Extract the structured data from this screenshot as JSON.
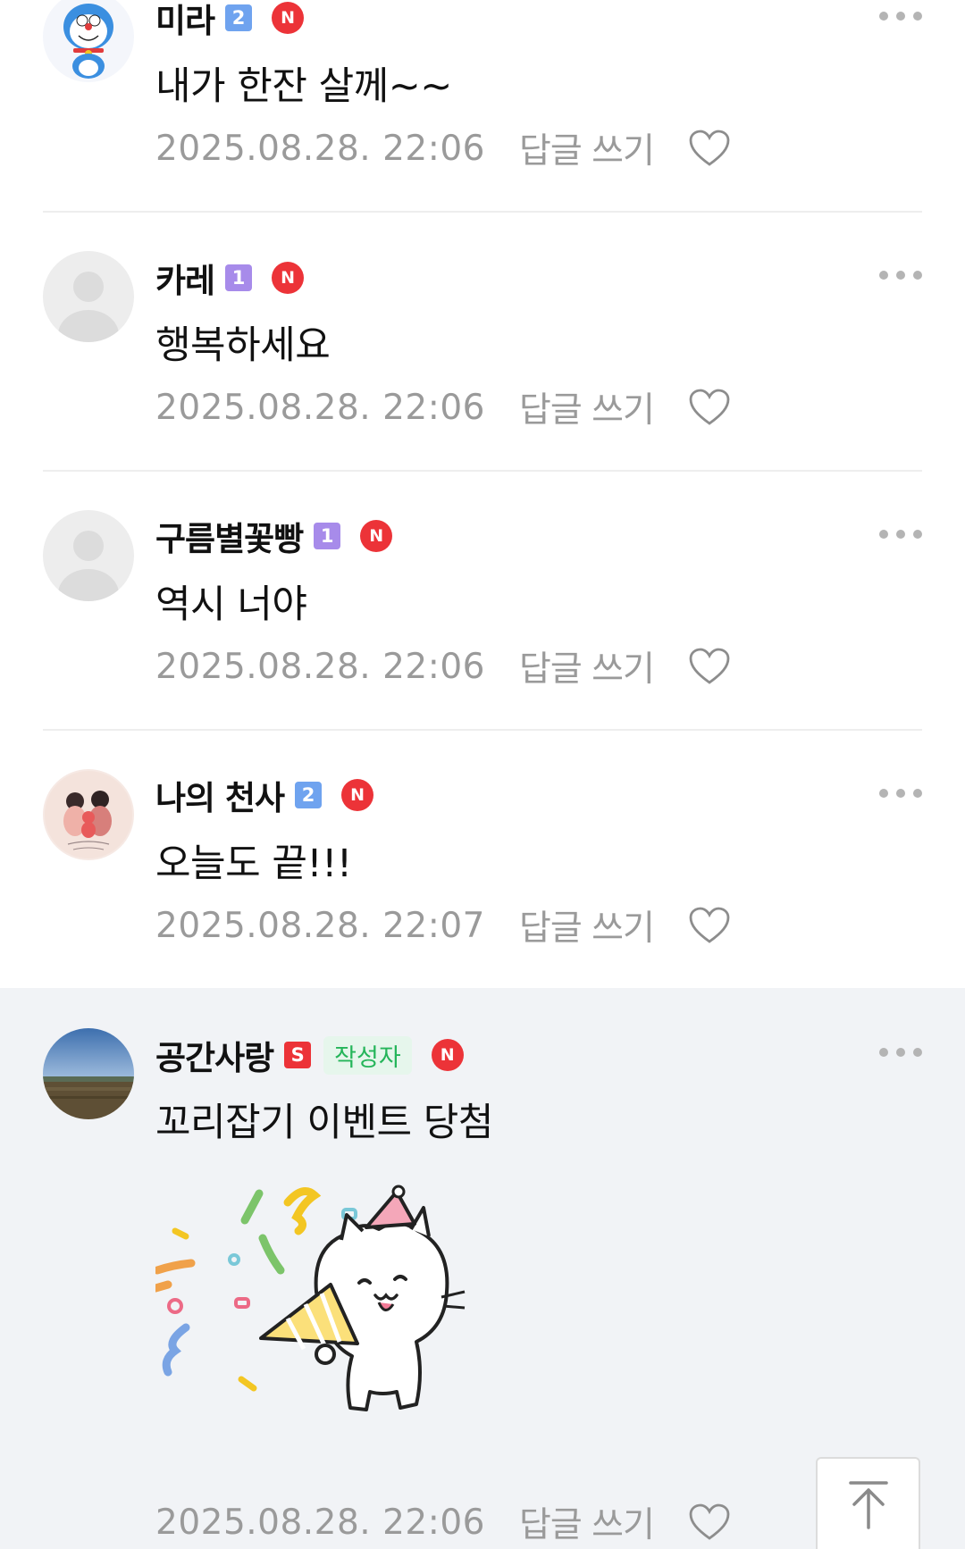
{
  "comments": [
    {
      "name": "미라",
      "level": "2",
      "level_color": "#6fa3ef",
      "new_badge": "N",
      "text": "내가 한잔 살께~~",
      "time": "2025.08.28. 22:06",
      "reply_label": "답글 쓰기",
      "avatar": "doraemon-avatar"
    },
    {
      "name": "카레",
      "level": "1",
      "level_color": "#a78bea",
      "new_badge": "N",
      "text": "행복하세요",
      "time": "2025.08.28. 22:06",
      "reply_label": "답글 쓰기",
      "avatar": "default-avatar"
    },
    {
      "name": "구름별꽃빵",
      "level": "1",
      "level_color": "#a78bea",
      "new_badge": "N",
      "text": "역시 너야",
      "time": "2025.08.28. 22:06",
      "reply_label": "답글 쓰기",
      "avatar": "default-avatar"
    },
    {
      "name": "나의 천사",
      "level": "2",
      "level_color": "#6fa3ef",
      "new_badge": "N",
      "text": "오늘도 끝!!!",
      "time": "2025.08.28. 22:07",
      "reply_label": "답글 쓰기",
      "avatar": "family-illustration-avatar"
    },
    {
      "name": "공간사랑",
      "level": "S",
      "level_color": "#ec3338",
      "author_badge": "작성자",
      "new_badge": "N",
      "text": "꼬리잡기 이벤트 당첨",
      "time": "2025.08.28. 22:06",
      "reply_label": "답글 쓰기",
      "avatar": "landscape-avatar",
      "sticker": "party-cat-sticker"
    }
  ],
  "icons": {
    "more": "more-dots-icon",
    "like": "heart-icon",
    "scroll_top": "arrow-up-to-top-icon"
  },
  "colors": {
    "new_badge": "#ec3338",
    "author_badge_text": "#25b55a",
    "author_badge_bg": "#e6f6ec",
    "meta_text": "#9a9a9a",
    "highlight_bg": "#f1f3f6"
  }
}
